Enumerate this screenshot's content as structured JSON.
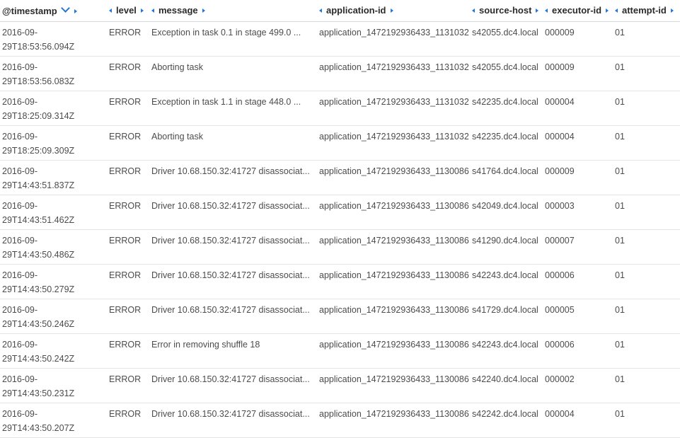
{
  "columns": [
    {
      "label": "@timestamp",
      "sortable": true,
      "left_arrow": false
    },
    {
      "label": "level",
      "sortable": false,
      "left_arrow": true
    },
    {
      "label": "message",
      "sortable": false,
      "left_arrow": true
    },
    {
      "label": "application-id",
      "sortable": false,
      "left_arrow": true
    },
    {
      "label": "source-host",
      "sortable": false,
      "left_arrow": true
    },
    {
      "label": "executor-id",
      "sortable": false,
      "left_arrow": true
    },
    {
      "label": "attempt-id",
      "sortable": false,
      "left_arrow": true
    }
  ],
  "rows": [
    {
      "ts_date": "2016-09-",
      "ts_time": "29T18:53:56.094Z",
      "level": "ERROR",
      "message": "Exception in task 0.1 in stage 499.0 ...",
      "app": "application_1472192936433_1131032",
      "host": "s42055.dc4.local",
      "executor": "000009",
      "attempt": "01"
    },
    {
      "ts_date": "2016-09-",
      "ts_time": "29T18:53:56.083Z",
      "level": "ERROR",
      "message": "Aborting task",
      "app": "application_1472192936433_1131032",
      "host": "s42055.dc4.local",
      "executor": "000009",
      "attempt": "01"
    },
    {
      "ts_date": "2016-09-",
      "ts_time": "29T18:25:09.314Z",
      "level": "ERROR",
      "message": "Exception in task 1.1 in stage 448.0 ...",
      "app": "application_1472192936433_1131032",
      "host": "s42235.dc4.local",
      "executor": "000004",
      "attempt": "01"
    },
    {
      "ts_date": "2016-09-",
      "ts_time": "29T18:25:09.309Z",
      "level": "ERROR",
      "message": "Aborting task",
      "app": "application_1472192936433_1131032",
      "host": "s42235.dc4.local",
      "executor": "000004",
      "attempt": "01"
    },
    {
      "ts_date": "2016-09-",
      "ts_time": "29T14:43:51.837Z",
      "level": "ERROR",
      "message": "Driver 10.68.150.32:41727 disassociat...",
      "app": "application_1472192936433_1130086",
      "host": "s41764.dc4.local",
      "executor": "000009",
      "attempt": "01"
    },
    {
      "ts_date": "2016-09-",
      "ts_time": "29T14:43:51.462Z",
      "level": "ERROR",
      "message": "Driver 10.68.150.32:41727 disassociat...",
      "app": "application_1472192936433_1130086",
      "host": "s42049.dc4.local",
      "executor": "000003",
      "attempt": "01"
    },
    {
      "ts_date": "2016-09-",
      "ts_time": "29T14:43:50.486Z",
      "level": "ERROR",
      "message": "Driver 10.68.150.32:41727 disassociat...",
      "app": "application_1472192936433_1130086",
      "host": "s41290.dc4.local",
      "executor": "000007",
      "attempt": "01"
    },
    {
      "ts_date": "2016-09-",
      "ts_time": "29T14:43:50.279Z",
      "level": "ERROR",
      "message": "Driver 10.68.150.32:41727 disassociat...",
      "app": "application_1472192936433_1130086",
      "host": "s42243.dc4.local",
      "executor": "000006",
      "attempt": "01"
    },
    {
      "ts_date": "2016-09-",
      "ts_time": "29T14:43:50.246Z",
      "level": "ERROR",
      "message": "Driver 10.68.150.32:41727 disassociat...",
      "app": "application_1472192936433_1130086",
      "host": "s41729.dc4.local",
      "executor": "000005",
      "attempt": "01"
    },
    {
      "ts_date": "2016-09-",
      "ts_time": "29T14:43:50.242Z",
      "level": "ERROR",
      "message": "Error in removing shuffle 18",
      "app": "application_1472192936433_1130086",
      "host": "s42243.dc4.local",
      "executor": "000006",
      "attempt": "01"
    },
    {
      "ts_date": "2016-09-",
      "ts_time": "29T14:43:50.231Z",
      "level": "ERROR",
      "message": "Driver 10.68.150.32:41727 disassociat...",
      "app": "application_1472192936433_1130086",
      "host": "s42240.dc4.local",
      "executor": "000002",
      "attempt": "01"
    },
    {
      "ts_date": "2016-09-",
      "ts_time": "29T14:43:50.207Z",
      "level": "ERROR",
      "message": "Driver 10.68.150.32:41727 disassociat...",
      "app": "application_1472192936433_1130086",
      "host": "s42242.dc4.local",
      "executor": "000004",
      "attempt": "01"
    }
  ]
}
